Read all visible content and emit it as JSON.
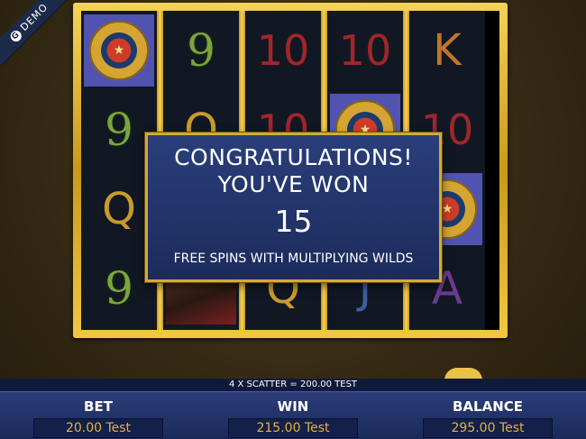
{
  "demo_label": "DEMO",
  "reels": [
    [
      {
        "type": "scatter",
        "label": "SCATTER"
      },
      {
        "type": "text",
        "text": "9",
        "cls": "sym-9"
      },
      {
        "type": "text",
        "text": "Q",
        "cls": "sym-q"
      },
      {
        "type": "text",
        "text": "9",
        "cls": "sym-9"
      }
    ],
    [
      {
        "type": "text",
        "text": "9",
        "cls": "sym-9"
      },
      {
        "type": "text",
        "text": "Q",
        "cls": "sym-q"
      },
      {
        "type": "text",
        "text": "",
        "cls": ""
      },
      {
        "type": "woman"
      }
    ],
    [
      {
        "type": "text",
        "text": "10",
        "cls": "sym-10"
      },
      {
        "type": "text",
        "text": "10",
        "cls": "sym-10"
      },
      {
        "type": "text",
        "text": "",
        "cls": ""
      },
      {
        "type": "text",
        "text": "Q",
        "cls": "sym-q"
      }
    ],
    [
      {
        "type": "text",
        "text": "10",
        "cls": "sym-10"
      },
      {
        "type": "scatter",
        "label": "SCATTER"
      },
      {
        "type": "text",
        "text": "",
        "cls": ""
      },
      {
        "type": "text",
        "text": "J",
        "cls": "sym-j"
      }
    ],
    [
      {
        "type": "text",
        "text": "K",
        "cls": "sym-k"
      },
      {
        "type": "text",
        "text": "10",
        "cls": "sym-10"
      },
      {
        "type": "scatter",
        "label": "SCATTER"
      },
      {
        "type": "text",
        "text": "A",
        "cls": "sym-a"
      }
    ]
  ],
  "popup": {
    "line1": "CONGRATULATIONS!",
    "line2": "YOU'VE WON",
    "count": "15",
    "description": "FREE SPINS WITH MULTIPLYING WILDS"
  },
  "win_line": "4 X SCATTER = 200.00 TEST",
  "stats": {
    "bet_label": "BET",
    "bet_value": "20.00 Test",
    "win_label": "WIN",
    "win_value": "215.00 Test",
    "balance_label": "BALANCE",
    "balance_value": "295.00 Test"
  }
}
